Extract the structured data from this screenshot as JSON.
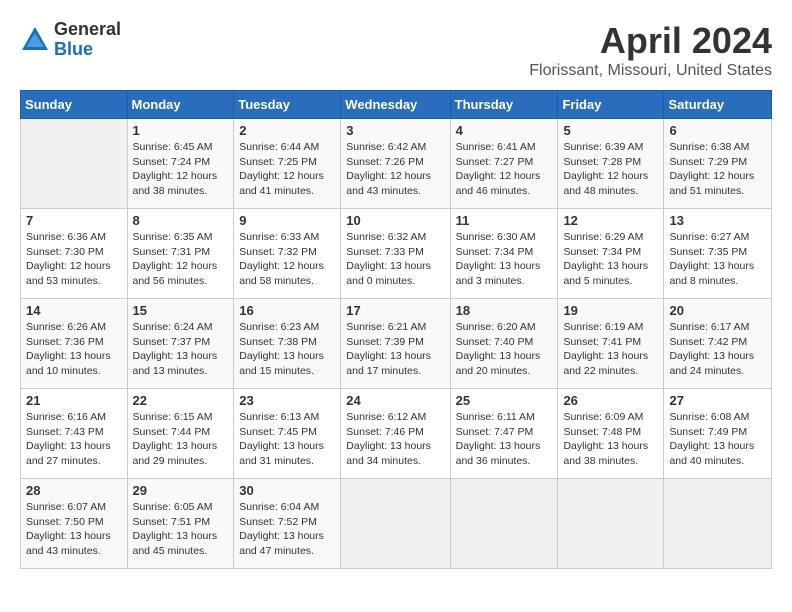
{
  "header": {
    "logo_general": "General",
    "logo_blue": "Blue",
    "month_title": "April 2024",
    "location": "Florissant, Missouri, United States"
  },
  "days_of_week": [
    "Sunday",
    "Monday",
    "Tuesday",
    "Wednesday",
    "Thursday",
    "Friday",
    "Saturday"
  ],
  "weeks": [
    [
      {
        "day": "",
        "sunrise": "",
        "sunset": "",
        "daylight": ""
      },
      {
        "day": "1",
        "sunrise": "Sunrise: 6:45 AM",
        "sunset": "Sunset: 7:24 PM",
        "daylight": "Daylight: 12 hours and 38 minutes."
      },
      {
        "day": "2",
        "sunrise": "Sunrise: 6:44 AM",
        "sunset": "Sunset: 7:25 PM",
        "daylight": "Daylight: 12 hours and 41 minutes."
      },
      {
        "day": "3",
        "sunrise": "Sunrise: 6:42 AM",
        "sunset": "Sunset: 7:26 PM",
        "daylight": "Daylight: 12 hours and 43 minutes."
      },
      {
        "day": "4",
        "sunrise": "Sunrise: 6:41 AM",
        "sunset": "Sunset: 7:27 PM",
        "daylight": "Daylight: 12 hours and 46 minutes."
      },
      {
        "day": "5",
        "sunrise": "Sunrise: 6:39 AM",
        "sunset": "Sunset: 7:28 PM",
        "daylight": "Daylight: 12 hours and 48 minutes."
      },
      {
        "day": "6",
        "sunrise": "Sunrise: 6:38 AM",
        "sunset": "Sunset: 7:29 PM",
        "daylight": "Daylight: 12 hours and 51 minutes."
      }
    ],
    [
      {
        "day": "7",
        "sunrise": "Sunrise: 6:36 AM",
        "sunset": "Sunset: 7:30 PM",
        "daylight": "Daylight: 12 hours and 53 minutes."
      },
      {
        "day": "8",
        "sunrise": "Sunrise: 6:35 AM",
        "sunset": "Sunset: 7:31 PM",
        "daylight": "Daylight: 12 hours and 56 minutes."
      },
      {
        "day": "9",
        "sunrise": "Sunrise: 6:33 AM",
        "sunset": "Sunset: 7:32 PM",
        "daylight": "Daylight: 12 hours and 58 minutes."
      },
      {
        "day": "10",
        "sunrise": "Sunrise: 6:32 AM",
        "sunset": "Sunset: 7:33 PM",
        "daylight": "Daylight: 13 hours and 0 minutes."
      },
      {
        "day": "11",
        "sunrise": "Sunrise: 6:30 AM",
        "sunset": "Sunset: 7:34 PM",
        "daylight": "Daylight: 13 hours and 3 minutes."
      },
      {
        "day": "12",
        "sunrise": "Sunrise: 6:29 AM",
        "sunset": "Sunset: 7:34 PM",
        "daylight": "Daylight: 13 hours and 5 minutes."
      },
      {
        "day": "13",
        "sunrise": "Sunrise: 6:27 AM",
        "sunset": "Sunset: 7:35 PM",
        "daylight": "Daylight: 13 hours and 8 minutes."
      }
    ],
    [
      {
        "day": "14",
        "sunrise": "Sunrise: 6:26 AM",
        "sunset": "Sunset: 7:36 PM",
        "daylight": "Daylight: 13 hours and 10 minutes."
      },
      {
        "day": "15",
        "sunrise": "Sunrise: 6:24 AM",
        "sunset": "Sunset: 7:37 PM",
        "daylight": "Daylight: 13 hours and 13 minutes."
      },
      {
        "day": "16",
        "sunrise": "Sunrise: 6:23 AM",
        "sunset": "Sunset: 7:38 PM",
        "daylight": "Daylight: 13 hours and 15 minutes."
      },
      {
        "day": "17",
        "sunrise": "Sunrise: 6:21 AM",
        "sunset": "Sunset: 7:39 PM",
        "daylight": "Daylight: 13 hours and 17 minutes."
      },
      {
        "day": "18",
        "sunrise": "Sunrise: 6:20 AM",
        "sunset": "Sunset: 7:40 PM",
        "daylight": "Daylight: 13 hours and 20 minutes."
      },
      {
        "day": "19",
        "sunrise": "Sunrise: 6:19 AM",
        "sunset": "Sunset: 7:41 PM",
        "daylight": "Daylight: 13 hours and 22 minutes."
      },
      {
        "day": "20",
        "sunrise": "Sunrise: 6:17 AM",
        "sunset": "Sunset: 7:42 PM",
        "daylight": "Daylight: 13 hours and 24 minutes."
      }
    ],
    [
      {
        "day": "21",
        "sunrise": "Sunrise: 6:16 AM",
        "sunset": "Sunset: 7:43 PM",
        "daylight": "Daylight: 13 hours and 27 minutes."
      },
      {
        "day": "22",
        "sunrise": "Sunrise: 6:15 AM",
        "sunset": "Sunset: 7:44 PM",
        "daylight": "Daylight: 13 hours and 29 minutes."
      },
      {
        "day": "23",
        "sunrise": "Sunrise: 6:13 AM",
        "sunset": "Sunset: 7:45 PM",
        "daylight": "Daylight: 13 hours and 31 minutes."
      },
      {
        "day": "24",
        "sunrise": "Sunrise: 6:12 AM",
        "sunset": "Sunset: 7:46 PM",
        "daylight": "Daylight: 13 hours and 34 minutes."
      },
      {
        "day": "25",
        "sunrise": "Sunrise: 6:11 AM",
        "sunset": "Sunset: 7:47 PM",
        "daylight": "Daylight: 13 hours and 36 minutes."
      },
      {
        "day": "26",
        "sunrise": "Sunrise: 6:09 AM",
        "sunset": "Sunset: 7:48 PM",
        "daylight": "Daylight: 13 hours and 38 minutes."
      },
      {
        "day": "27",
        "sunrise": "Sunrise: 6:08 AM",
        "sunset": "Sunset: 7:49 PM",
        "daylight": "Daylight: 13 hours and 40 minutes."
      }
    ],
    [
      {
        "day": "28",
        "sunrise": "Sunrise: 6:07 AM",
        "sunset": "Sunset: 7:50 PM",
        "daylight": "Daylight: 13 hours and 43 minutes."
      },
      {
        "day": "29",
        "sunrise": "Sunrise: 6:05 AM",
        "sunset": "Sunset: 7:51 PM",
        "daylight": "Daylight: 13 hours and 45 minutes."
      },
      {
        "day": "30",
        "sunrise": "Sunrise: 6:04 AM",
        "sunset": "Sunset: 7:52 PM",
        "daylight": "Daylight: 13 hours and 47 minutes."
      },
      {
        "day": "",
        "sunrise": "",
        "sunset": "",
        "daylight": ""
      },
      {
        "day": "",
        "sunrise": "",
        "sunset": "",
        "daylight": ""
      },
      {
        "day": "",
        "sunrise": "",
        "sunset": "",
        "daylight": ""
      },
      {
        "day": "",
        "sunrise": "",
        "sunset": "",
        "daylight": ""
      }
    ]
  ]
}
